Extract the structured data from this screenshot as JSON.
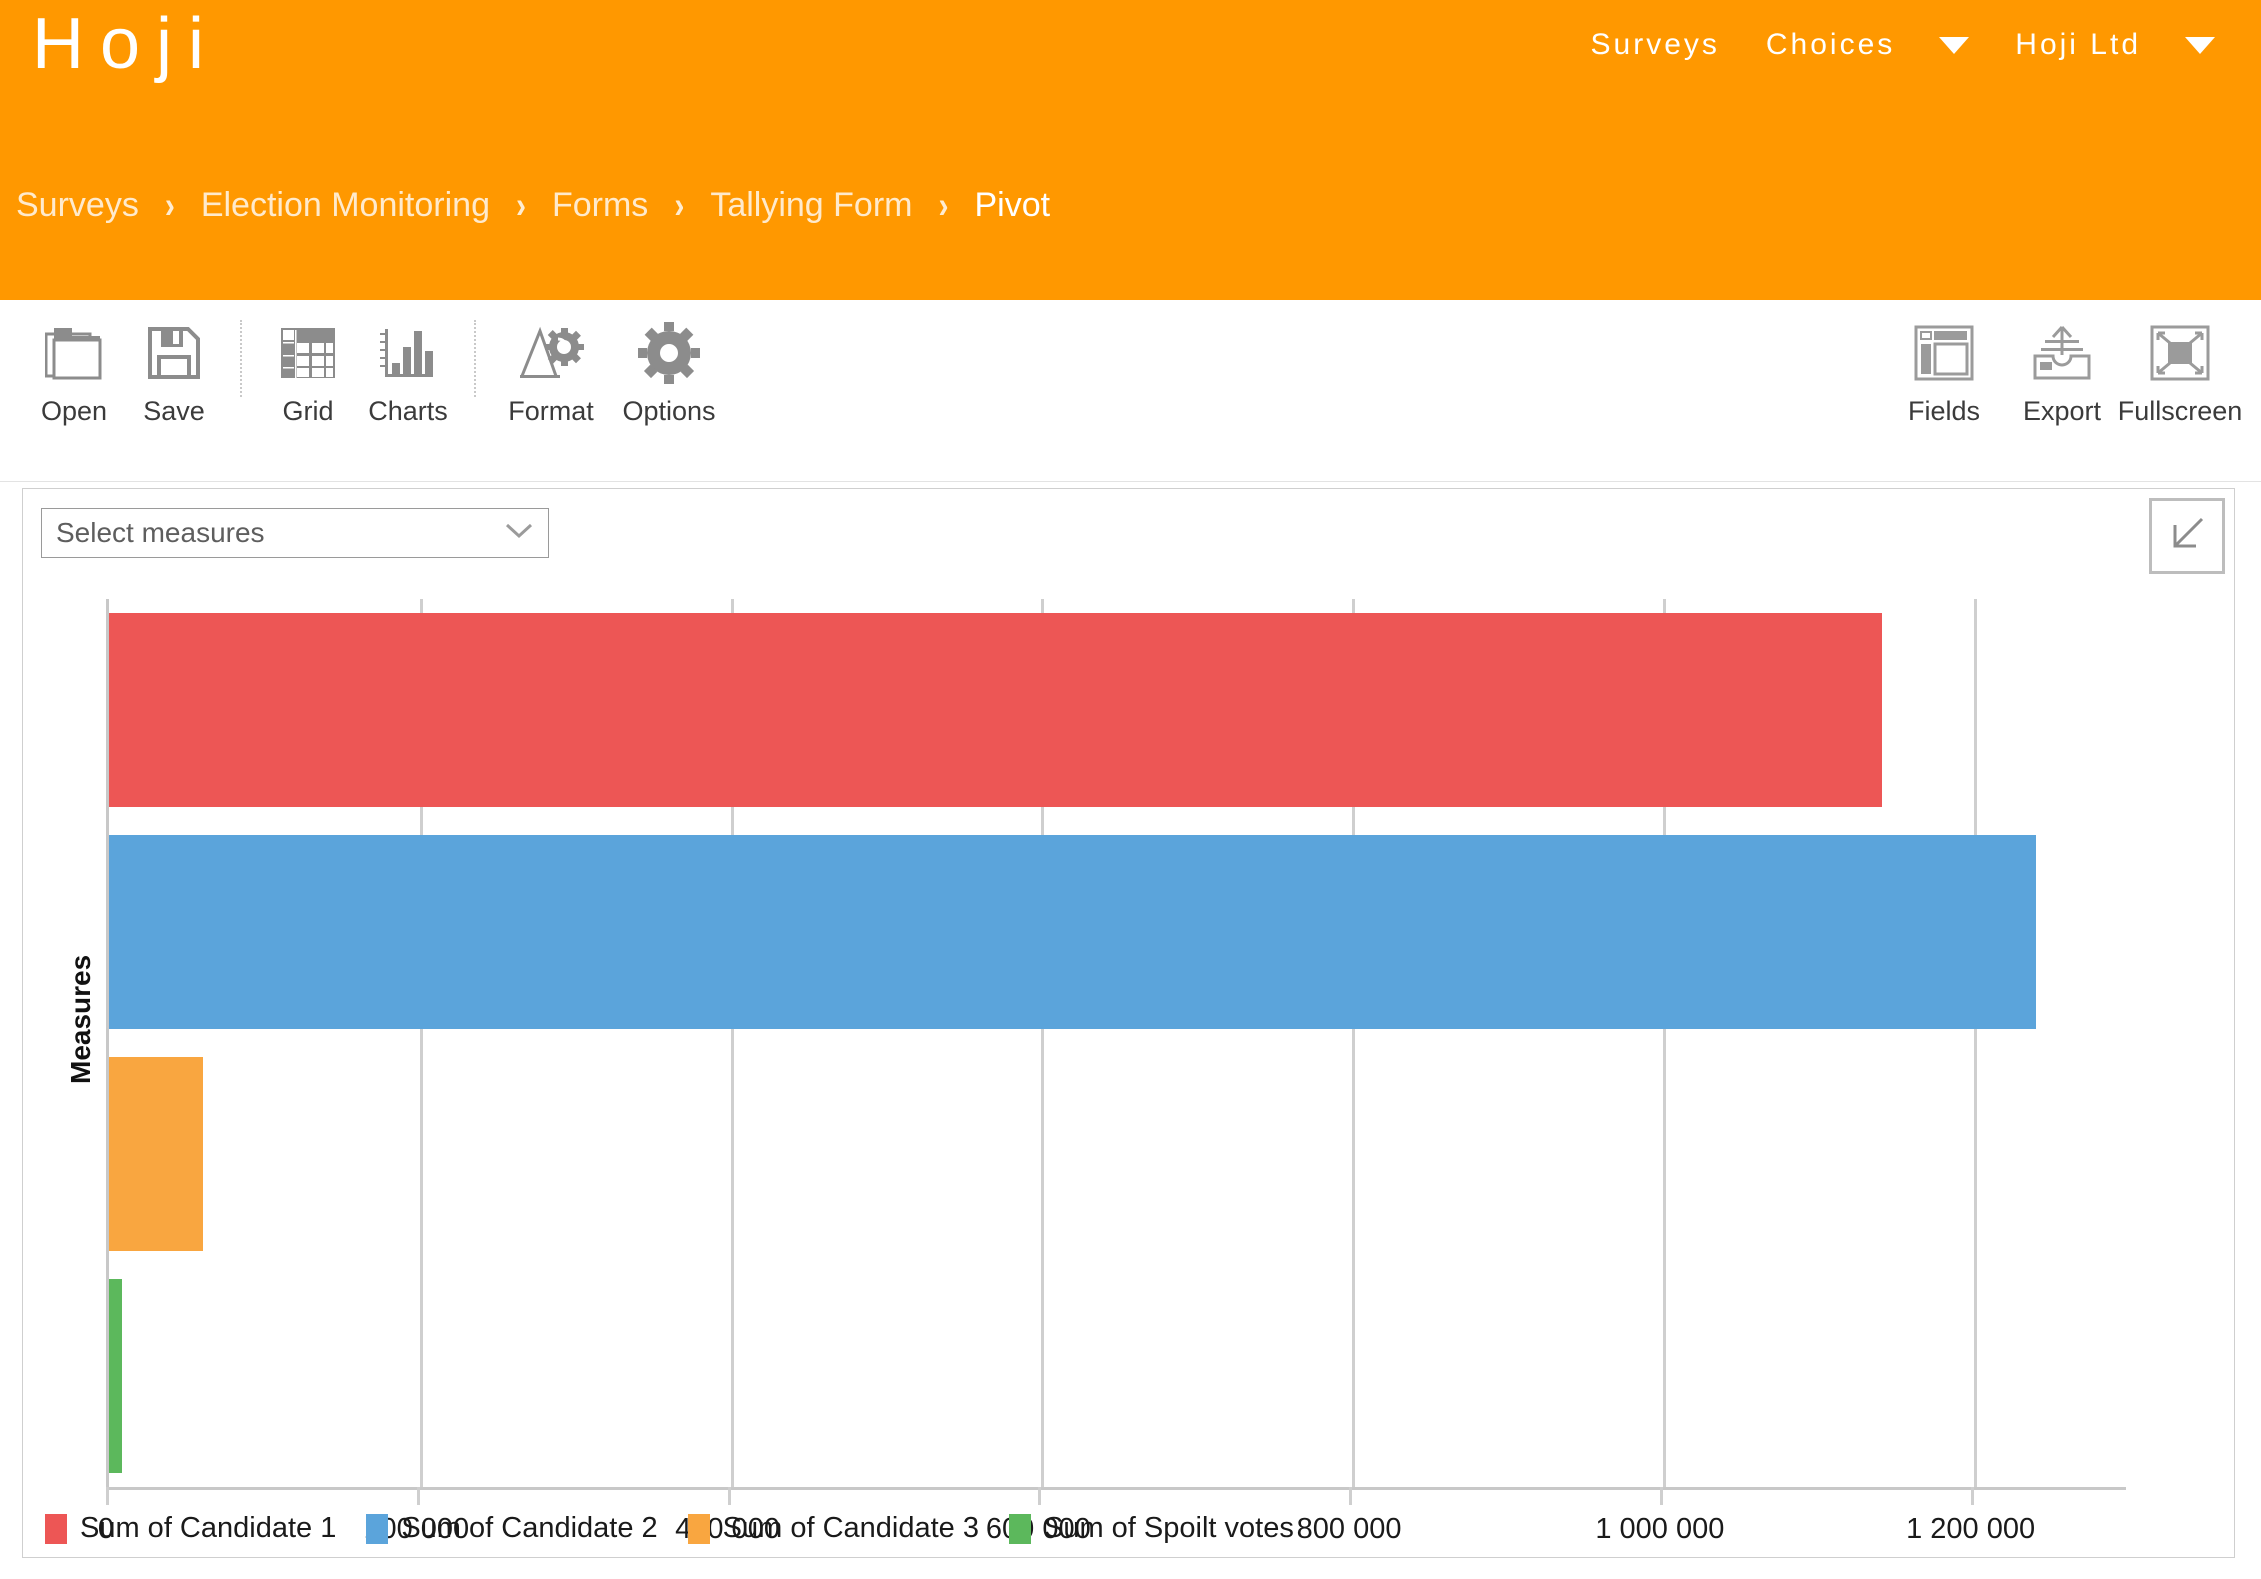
{
  "header": {
    "brand": "Hoji",
    "nav": [
      {
        "label": "Surveys",
        "caret": false
      },
      {
        "label": "Choices",
        "caret": true
      },
      {
        "label": "Hoji Ltd",
        "caret": true
      }
    ],
    "breadcrumb": [
      {
        "label": "Surveys",
        "active": false
      },
      {
        "label": "Election Monitoring",
        "active": false
      },
      {
        "label": "Forms",
        "active": false
      },
      {
        "label": "Tallying Form",
        "active": false
      },
      {
        "label": "Pivot",
        "active": true
      }
    ],
    "separator": "›",
    "bg_color": "#ff9800"
  },
  "toolbar": {
    "left": [
      {
        "label": "Open",
        "icon": "folder-open-icon"
      },
      {
        "label": "Save",
        "icon": "floppy-disk-icon"
      },
      {
        "divider": true
      },
      {
        "label": "Grid",
        "icon": "grid-table-icon"
      },
      {
        "label": "Charts",
        "icon": "bar-chart-icon"
      },
      {
        "divider": true
      },
      {
        "label": "Format",
        "icon": "format-text-icon"
      },
      {
        "label": "Options",
        "icon": "gear-icon"
      }
    ],
    "right": [
      {
        "label": "Fields",
        "icon": "fields-panel-icon"
      },
      {
        "label": "Export",
        "icon": "export-upload-icon"
      },
      {
        "label": "Fullscreen",
        "icon": "fullscreen-expand-icon"
      }
    ]
  },
  "panel": {
    "measure_select": {
      "value": "Select measures",
      "chevron": "chevron-down-icon"
    },
    "collapse_button": {
      "icon": "arrow-down-left-icon"
    }
  },
  "chart_data": {
    "type": "bar",
    "orientation": "horizontal",
    "title": "",
    "xlabel": "",
    "ylabel": "Measures",
    "grid": true,
    "legend_position": "bottom",
    "xlim": [
      0,
      1300000
    ],
    "xticks": [
      0,
      200000,
      400000,
      600000,
      800000,
      1000000,
      1200000
    ],
    "xticklabels": [
      "0",
      "200 000",
      "400 000",
      "600 000",
      "800 000",
      "1 000 000",
      "1 200 000"
    ],
    "categories": [
      "Sum of Candidate 1",
      "Sum of Candidate 2",
      "Sum of Candidate 3",
      "Sum of Spoilt votes"
    ],
    "values": [
      1141000,
      1240000,
      60500,
      8500
    ],
    "colors": [
      "#ED5655",
      "#5BA4DB",
      "#F9A640",
      "#5CB85C"
    ],
    "legend": [
      {
        "label": "Sum of Candidate 1",
        "color": "#ED5655"
      },
      {
        "label": "Sum of Candidate 2",
        "color": "#5BA4DB"
      },
      {
        "label": "Sum of Candidate 3",
        "color": "#F9A640"
      },
      {
        "label": "Sum of Spoilt votes",
        "color": "#5CB85C"
      }
    ]
  }
}
